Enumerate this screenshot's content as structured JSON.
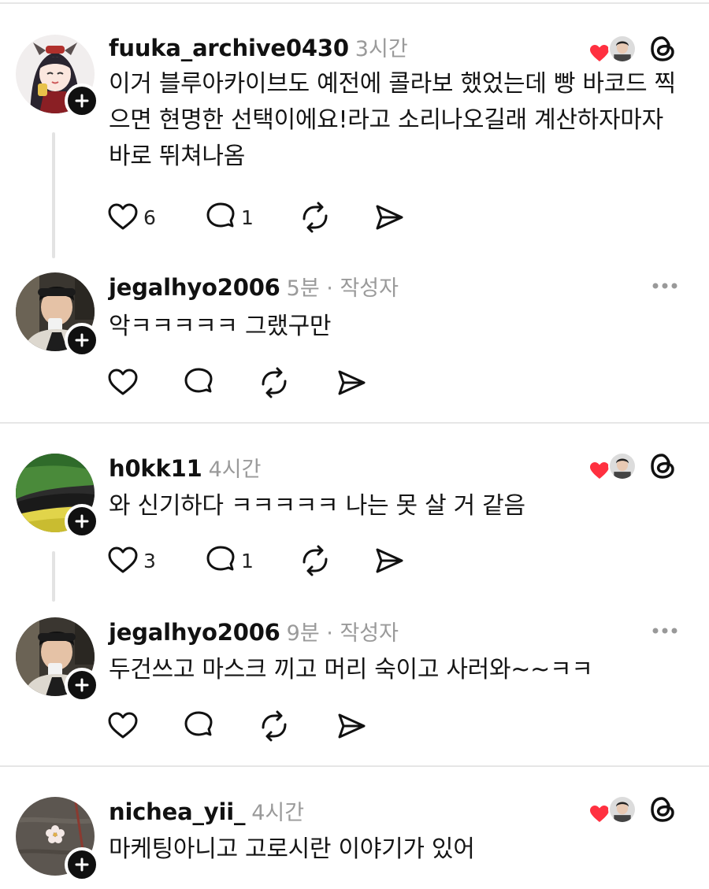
{
  "posts": [
    {
      "username": "fuuka_archive0430",
      "time": "3시간",
      "text": "이거 블루아카이브도 예전에 콜라보 했었는데 빵 바코드 찍으면 현명한 선택이에요!라고 소리나오길래 계산하자마자 바로 뛰쳐나옴",
      "likes": "6",
      "replies": "1"
    },
    {
      "username": "jegalhyo2006",
      "meta": "5분 · 작성자",
      "text": "악ㅋㅋㅋㅋㅋ 그랬구만"
    },
    {
      "username": "h0kk11",
      "time": "4시간",
      "text": "와 신기하다 ㅋㅋㅋㅋㅋ 나는 못 살 거 같음",
      "likes": "3",
      "replies": "1"
    },
    {
      "username": "jegalhyo2006",
      "meta": "9분 · 작성자",
      "text": "두건쓰고 마스크 끼고 머리 숙이고 사러와~~ㅋㅋ"
    },
    {
      "username": "nichea_yii_",
      "time": "4시간",
      "text": "마케팅아니고 고로시란 이야기가 있어"
    }
  ],
  "icons": {
    "like": "heart-outline",
    "reply": "speech-bubble",
    "repost": "repost-arrows",
    "share": "paper-plane",
    "threads": "threads-logo",
    "more": "three-dots",
    "follow": "plus"
  },
  "colors": {
    "text": "#101010",
    "muted": "#9a9a9a",
    "divider": "#e6e6e6",
    "heart_red": "#ff3040"
  }
}
